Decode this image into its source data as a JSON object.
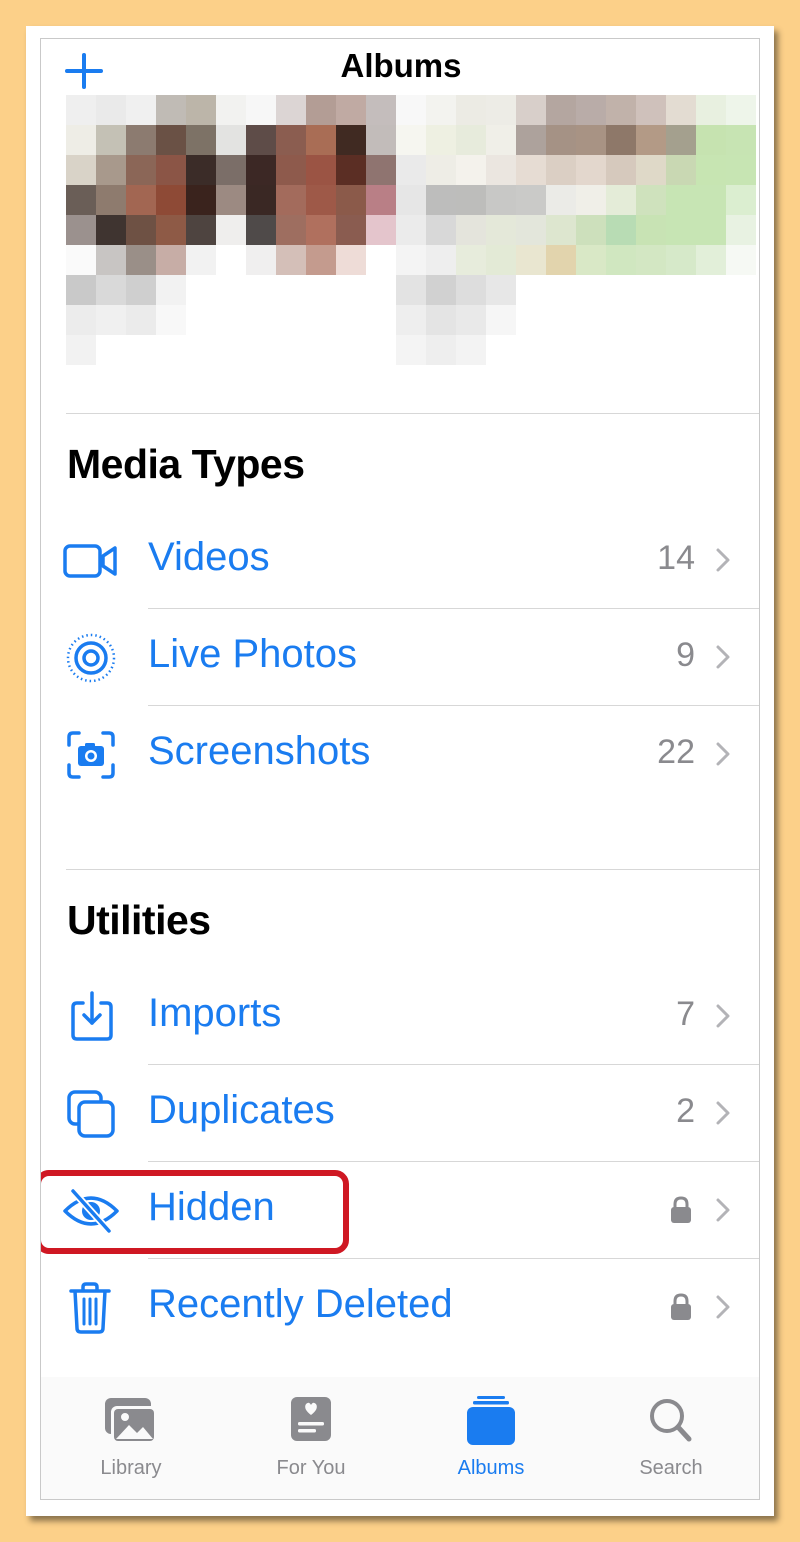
{
  "header": {
    "title": "Albums",
    "add_icon": "plus-icon"
  },
  "media_types": {
    "title": "Media Types",
    "items": [
      {
        "label": "Videos",
        "count": "14",
        "icon": "video-icon"
      },
      {
        "label": "Live Photos",
        "count": "9",
        "icon": "live-photo-icon"
      },
      {
        "label": "Screenshots",
        "count": "22",
        "icon": "screenshot-icon"
      }
    ]
  },
  "utilities": {
    "title": "Utilities",
    "items": [
      {
        "label": "Imports",
        "count": "7",
        "icon": "import-icon"
      },
      {
        "label": "Duplicates",
        "count": "2",
        "icon": "duplicates-icon"
      },
      {
        "label": "Hidden",
        "locked": true,
        "icon": "eye-slash-icon"
      },
      {
        "label": "Recently Deleted",
        "locked": true,
        "icon": "trash-icon"
      }
    ]
  },
  "tabbar": {
    "tabs": [
      {
        "label": "Library",
        "icon": "photo-library-icon",
        "active": false
      },
      {
        "label": "For You",
        "icon": "for-you-icon",
        "active": false
      },
      {
        "label": "Albums",
        "icon": "albums-icon",
        "active": true
      },
      {
        "label": "Search",
        "icon": "search-icon",
        "active": false
      }
    ]
  },
  "colors": {
    "accent": "#1a7cf0",
    "highlight": "#cf1823",
    "background": "#fcd089"
  }
}
